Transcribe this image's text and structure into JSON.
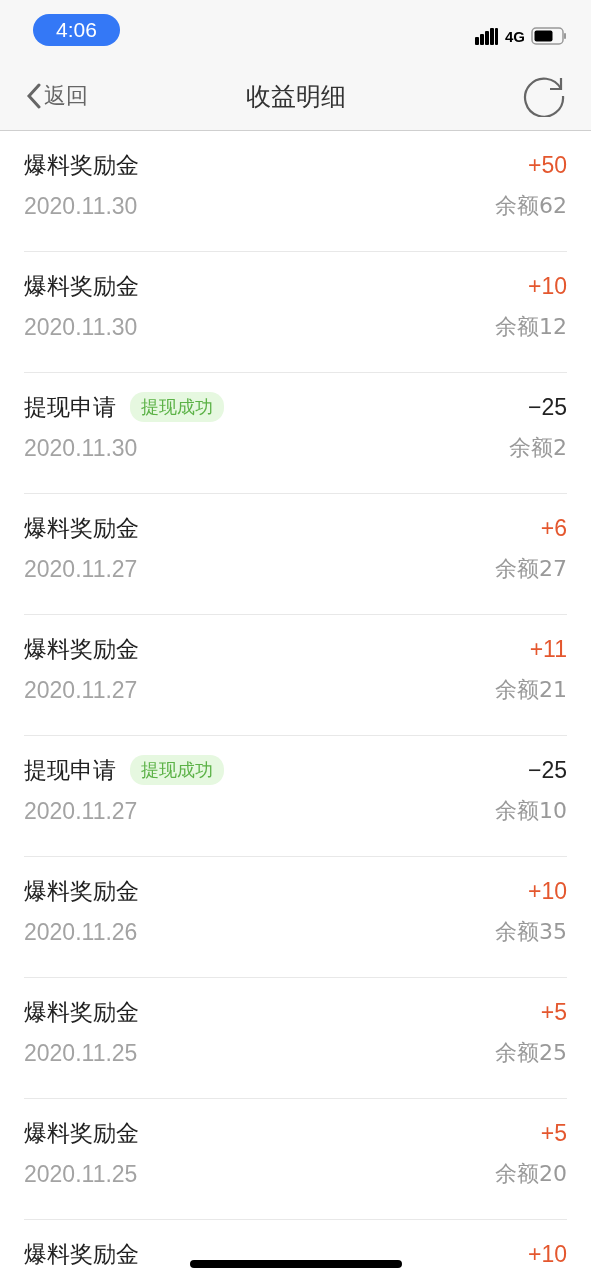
{
  "status_bar": {
    "time": "4:06",
    "network": "4G"
  },
  "nav": {
    "back": "返回",
    "title": "收益明细"
  },
  "records": [
    {
      "title": "爆料奖励金",
      "date": "2020.11.30",
      "amount": "+50",
      "kind": "income",
      "balance": "余额62"
    },
    {
      "title": "爆料奖励金",
      "date": "2020.11.30",
      "amount": "+10",
      "kind": "income",
      "balance": "余额12"
    },
    {
      "title": "提现申请",
      "badge": "提现成功",
      "date": "2020.11.30",
      "amount": "−25",
      "kind": "expense",
      "balance": "余额2"
    },
    {
      "title": "爆料奖励金",
      "date": "2020.11.27",
      "amount": "+6",
      "kind": "income",
      "balance": "余额27"
    },
    {
      "title": "爆料奖励金",
      "date": "2020.11.27",
      "amount": "+11",
      "kind": "income",
      "balance": "余额21"
    },
    {
      "title": "提现申请",
      "badge": "提现成功",
      "date": "2020.11.27",
      "amount": "−25",
      "kind": "expense",
      "balance": "余额10"
    },
    {
      "title": "爆料奖励金",
      "date": "2020.11.26",
      "amount": "+10",
      "kind": "income",
      "balance": "余额35"
    },
    {
      "title": "爆料奖励金",
      "date": "2020.11.25",
      "amount": "+5",
      "kind": "income",
      "balance": "余额25"
    },
    {
      "title": "爆料奖励金",
      "date": "2020.11.25",
      "amount": "+5",
      "kind": "income",
      "balance": "余额20"
    },
    {
      "title": "爆料奖励金",
      "amount": "+10",
      "kind": "income"
    }
  ]
}
